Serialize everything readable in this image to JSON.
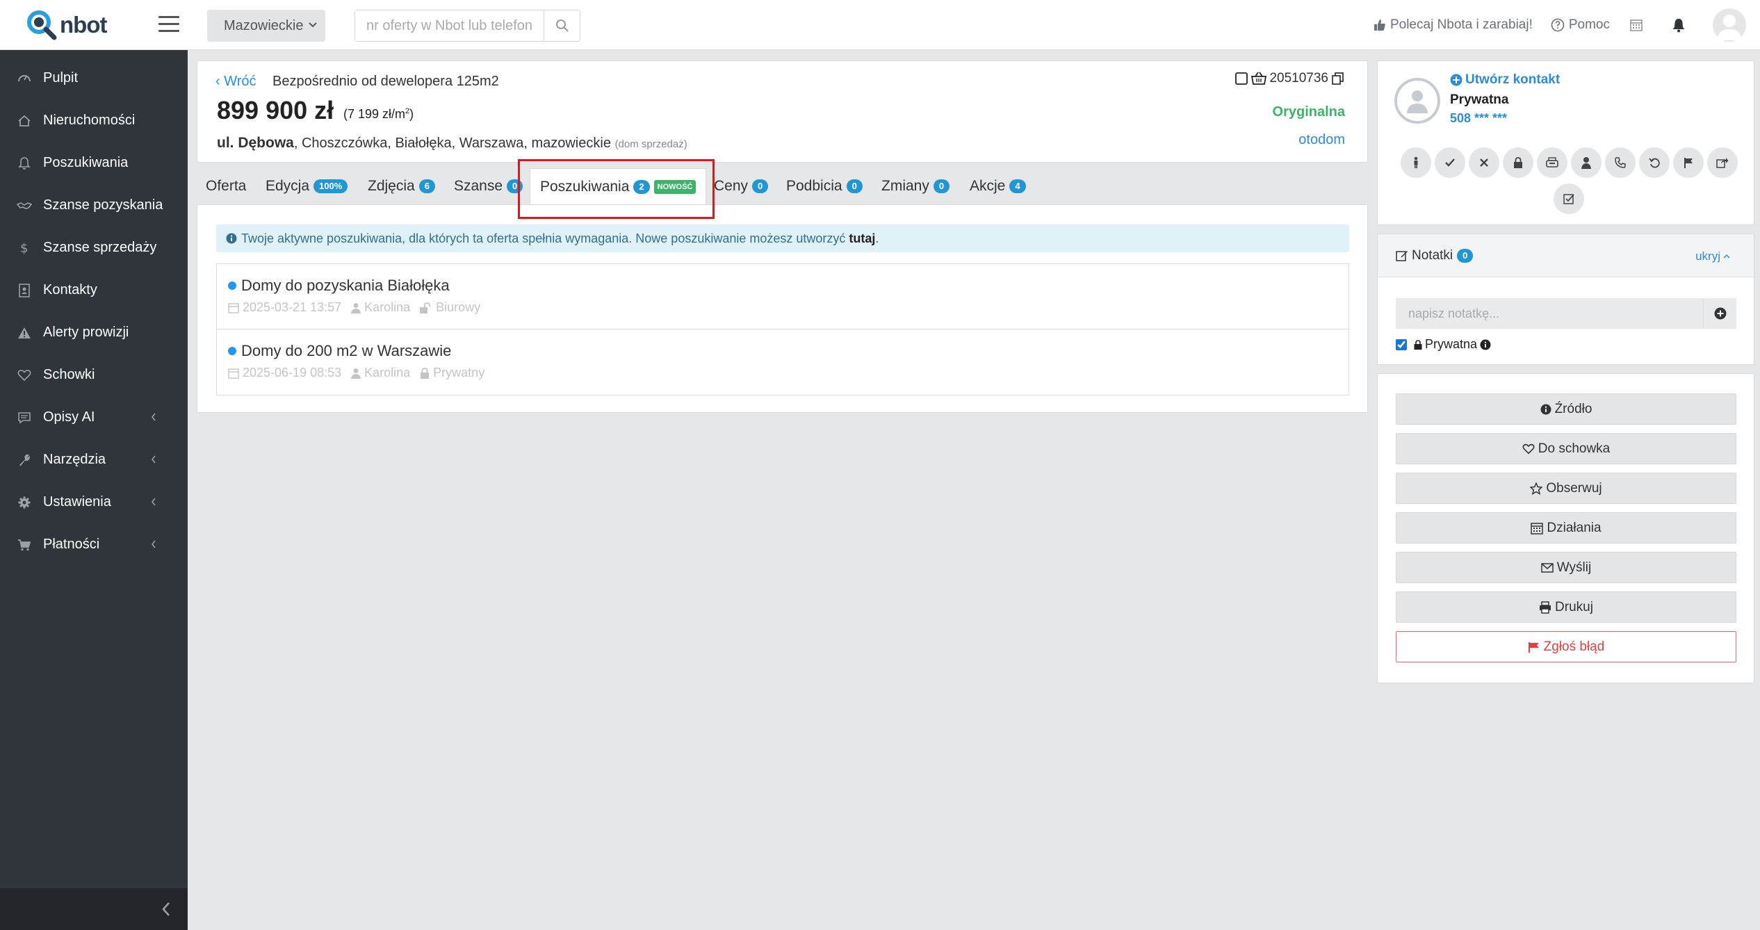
{
  "header": {
    "logo_text": "nbot",
    "region": "Mazowieckie",
    "search_placeholder": "nr oferty w Nbot lub telefon",
    "refer_label": "Polecaj Nbota i zarabiaj!",
    "help_label": "Pomoc"
  },
  "sidebar": {
    "items": [
      {
        "label": "Pulpit",
        "icon": "dashboard-icon"
      },
      {
        "label": "Nieruchomości",
        "icon": "home-icon"
      },
      {
        "label": "Poszukiwania",
        "icon": "bell-icon"
      },
      {
        "label": "Szanse pozyskania",
        "icon": "handshake-icon"
      },
      {
        "label": "Szanse sprzedaży",
        "icon": "dollar-icon"
      },
      {
        "label": "Kontakty",
        "icon": "contact-book-icon"
      },
      {
        "label": "Alerty prowizji",
        "icon": "warning-icon"
      },
      {
        "label": "Schowki",
        "icon": "heart-icon"
      },
      {
        "label": "Opisy AI",
        "icon": "comment-icon"
      },
      {
        "label": "Narzędzia",
        "icon": "wrench-icon"
      },
      {
        "label": "Ustawienia",
        "icon": "gear-icon"
      },
      {
        "label": "Płatności",
        "icon": "cart-icon"
      }
    ]
  },
  "offer": {
    "back_label": "Wróć",
    "title": "Bezpośrednio od dewelopera 125m2",
    "price": "899 900 zł",
    "price_per_m2": "(7 199 zł/m",
    "price_per_m2_sup": "2",
    "price_per_m2_close": ")",
    "street": "ul. Dębowa",
    "address_rest": ", Choszczówka, Białołęka, Warszawa, mazowieckie",
    "address_tag": "(dom sprzedaż)",
    "id": "20510736",
    "origin": "Oryginalna",
    "source": "otodom"
  },
  "tabs": [
    {
      "label": "Oferta"
    },
    {
      "label": "Edycja",
      "badge": "100%"
    },
    {
      "label": "Zdjęcia",
      "badge": "6"
    },
    {
      "label": "Szanse",
      "badge": "0"
    },
    {
      "label": "Poszukiwania",
      "badge": "2",
      "badge_new": "NOWOŚĆ"
    },
    {
      "label": "Ceny",
      "badge": "0"
    },
    {
      "label": "Podbicia",
      "badge": "0"
    },
    {
      "label": "Zmiany",
      "badge": "0"
    },
    {
      "label": "Akcje",
      "badge": "4"
    }
  ],
  "panel": {
    "info_text": "Twoje aktywne poszukiwania, dla których ta oferta spełnia wymagania. Nowe poszukiwanie możesz utworzyć",
    "info_link": "tutaj",
    "info_end": ".",
    "searches": [
      {
        "name": "Domy do pozyskania Białołęka",
        "date": "2025-03-21 13:57",
        "user": "Karolina",
        "visibility": "Biurowy"
      },
      {
        "name": "Domy do 200 m2 w Warszawie",
        "date": "2025-06-19 08:53",
        "user": "Karolina",
        "visibility": "Prywatny"
      }
    ]
  },
  "contact": {
    "create_label": "Utwórz kontakt",
    "type": "Prywatna",
    "phone": "508 *** ***"
  },
  "notes": {
    "title": "Notatki",
    "count": "0",
    "hide_label": "ukryj",
    "placeholder": "napisz notatkę...",
    "private_label": "Prywatna"
  },
  "actions": {
    "source": "Źródło",
    "clipboard": "Do schowka",
    "watch": "Obserwuj",
    "activities": "Działania",
    "send": "Wyślij",
    "print": "Drukuj",
    "report": "Zgłoś błąd"
  },
  "colors": {
    "accent": "#2196d3",
    "link": "#2e8bd8",
    "success": "#3db36a",
    "sidebar_bg": "#2f353a",
    "danger": "#e04040"
  }
}
